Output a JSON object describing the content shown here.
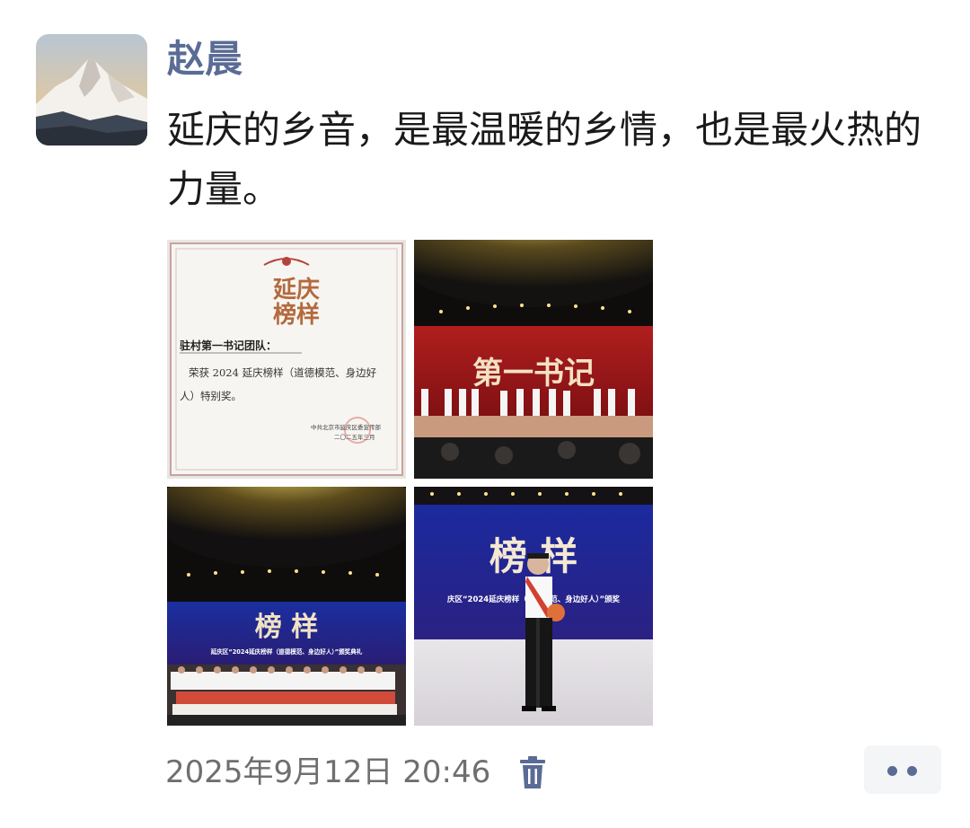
{
  "post": {
    "author": "赵晨",
    "text": "延庆的乡音，是最温暖的乡情，也是最火热的力量。",
    "timestamp": "2025年9月12日 20:46"
  },
  "photos": [
    {
      "logo_line1": "延庆",
      "logo_line2": "榜样",
      "recipient": "驻村第一书记团队：",
      "body_line1": "荣获 2024 延庆榜样（道德模范、身边好",
      "body_line2": "人）特别奖。",
      "issuer": "中共北京市延庆区委宣传部",
      "date": "二〇二五年三月"
    },
    {
      "screen_text": "第一书记"
    },
    {
      "screen_title": "榜 样",
      "screen_sub": "延庆区“2024延庆榜样（道德模范、身边好人）”颁奖典礼"
    },
    {
      "screen_title": "榜 样",
      "screen_sub": "庆区“2024延庆榜样（道德模范、身边好人）”颁奖"
    }
  ],
  "icons": {
    "delete": "trash-icon",
    "more": "more-dots-icon"
  },
  "colors": {
    "author": "#5a6c95",
    "timestamp": "#6f6f6f",
    "accent": "#5a6c95"
  }
}
